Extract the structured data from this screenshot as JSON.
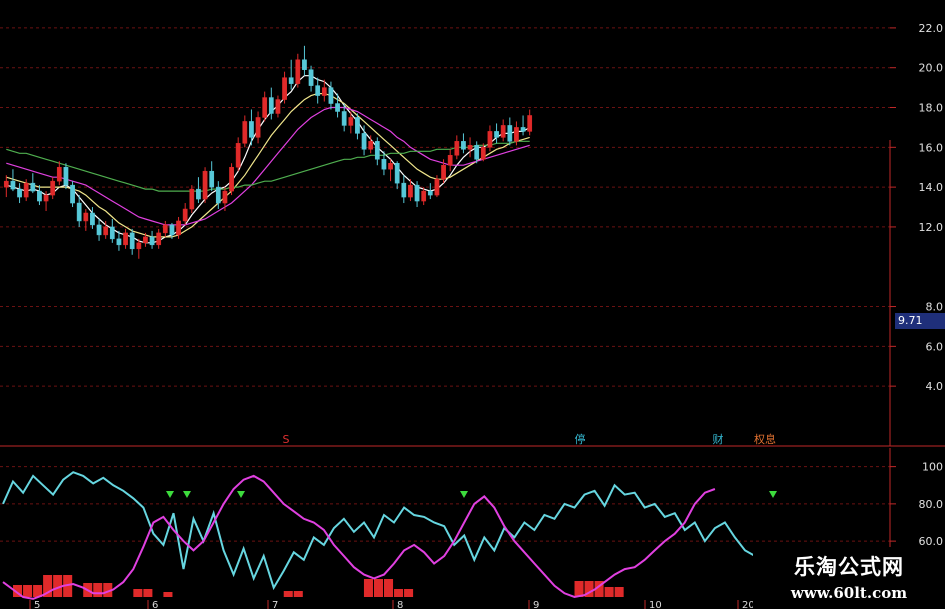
{
  "chart_data": [
    {
      "type": "candlestick",
      "panel": "price",
      "y_ticks": [
        "22.0",
        "20.0",
        "18.0",
        "16.0",
        "14.0",
        "12.0",
        "8.0",
        "6.0",
        "4.0"
      ],
      "current_price": "9.71",
      "ylim": [
        2.5,
        23.0
      ],
      "grid": true,
      "candles": [
        [
          14.0,
          14.6,
          13.5,
          14.3
        ],
        [
          14.3,
          14.9,
          13.8,
          13.9
        ],
        [
          13.9,
          14.2,
          13.2,
          13.5
        ],
        [
          13.5,
          14.4,
          13.3,
          14.2
        ],
        [
          14.2,
          14.7,
          13.7,
          13.8
        ],
        [
          13.8,
          14.1,
          13.1,
          13.3
        ],
        [
          13.3,
          13.8,
          12.8,
          13.6
        ],
        [
          13.6,
          14.5,
          13.4,
          14.3
        ],
        [
          14.3,
          15.3,
          14.1,
          15.0
        ],
        [
          15.0,
          15.2,
          13.9,
          14.1
        ],
        [
          14.1,
          14.3,
          13.0,
          13.2
        ],
        [
          13.2,
          13.6,
          12.0,
          12.3
        ],
        [
          12.3,
          12.9,
          11.8,
          12.7
        ],
        [
          12.7,
          13.0,
          11.9,
          12.1
        ],
        [
          12.1,
          12.4,
          11.3,
          11.6
        ],
        [
          11.6,
          12.3,
          11.4,
          12.0
        ],
        [
          12.0,
          12.4,
          11.2,
          11.4
        ],
        [
          11.4,
          11.8,
          10.8,
          11.1
        ],
        [
          11.1,
          11.9,
          10.9,
          11.7
        ],
        [
          11.7,
          11.9,
          10.6,
          10.9
        ],
        [
          10.9,
          11.4,
          10.4,
          11.2
        ],
        [
          11.2,
          11.7,
          11.0,
          11.5
        ],
        [
          11.5,
          11.8,
          10.9,
          11.1
        ],
        [
          11.1,
          11.9,
          10.9,
          11.7
        ],
        [
          11.7,
          12.3,
          11.5,
          12.1
        ],
        [
          12.1,
          12.2,
          11.4,
          11.6
        ],
        [
          11.6,
          12.5,
          11.4,
          12.3
        ],
        [
          12.3,
          13.2,
          12.1,
          12.9
        ],
        [
          12.9,
          14.1,
          12.7,
          13.9
        ],
        [
          13.9,
          14.5,
          13.2,
          13.4
        ],
        [
          13.4,
          15.0,
          13.2,
          14.8
        ],
        [
          14.8,
          15.3,
          13.8,
          14.0
        ],
        [
          14.0,
          14.3,
          12.9,
          13.2
        ],
        [
          13.2,
          14.0,
          12.8,
          13.8
        ],
        [
          13.8,
          15.2,
          13.6,
          15.0
        ],
        [
          15.0,
          16.5,
          14.8,
          16.2
        ],
        [
          16.2,
          17.6,
          16.0,
          17.3
        ],
        [
          17.3,
          17.9,
          16.1,
          16.5
        ],
        [
          16.5,
          17.8,
          16.2,
          17.5
        ],
        [
          17.5,
          18.8,
          17.3,
          18.5
        ],
        [
          18.5,
          19.0,
          17.4,
          17.7
        ],
        [
          17.7,
          18.6,
          17.5,
          18.4
        ],
        [
          18.4,
          19.8,
          18.2,
          19.5
        ],
        [
          19.5,
          20.4,
          18.9,
          19.2
        ],
        [
          19.2,
          20.7,
          19.0,
          20.4
        ],
        [
          20.4,
          21.1,
          19.6,
          19.9
        ],
        [
          19.9,
          20.1,
          18.8,
          19.1
        ],
        [
          19.1,
          19.5,
          18.2,
          18.6
        ],
        [
          18.6,
          19.4,
          18.3,
          19.0
        ],
        [
          19.0,
          19.3,
          17.9,
          18.2
        ],
        [
          18.2,
          18.7,
          17.5,
          17.8
        ],
        [
          17.8,
          18.2,
          16.8,
          17.1
        ],
        [
          17.1,
          17.8,
          16.7,
          17.5
        ],
        [
          17.5,
          17.7,
          16.4,
          16.7
        ],
        [
          16.7,
          17.1,
          15.6,
          15.9
        ],
        [
          15.9,
          16.6,
          15.7,
          16.3
        ],
        [
          16.3,
          16.5,
          15.1,
          15.4
        ],
        [
          15.4,
          15.8,
          14.6,
          14.9
        ],
        [
          14.9,
          15.4,
          14.3,
          15.2
        ],
        [
          15.2,
          15.3,
          13.9,
          14.2
        ],
        [
          14.2,
          14.6,
          13.2,
          13.5
        ],
        [
          13.5,
          14.4,
          13.3,
          14.1
        ],
        [
          14.1,
          14.3,
          13.0,
          13.3
        ],
        [
          13.3,
          14.0,
          13.1,
          13.8
        ],
        [
          13.8,
          14.2,
          13.4,
          13.6
        ],
        [
          13.6,
          14.6,
          13.5,
          14.4
        ],
        [
          14.4,
          15.4,
          14.2,
          15.1
        ],
        [
          15.1,
          15.9,
          14.8,
          15.6
        ],
        [
          15.6,
          16.6,
          15.4,
          16.3
        ],
        [
          16.3,
          16.7,
          15.7,
          15.9
        ],
        [
          15.9,
          16.5,
          15.5,
          16.1
        ],
        [
          16.1,
          16.3,
          15.2,
          15.4
        ],
        [
          15.4,
          16.2,
          15.3,
          16.0
        ],
        [
          16.0,
          17.1,
          15.8,
          16.8
        ],
        [
          16.8,
          17.2,
          16.2,
          16.5
        ],
        [
          16.5,
          17.4,
          16.3,
          17.1
        ],
        [
          17.1,
          17.5,
          16.1,
          16.3
        ],
        [
          16.3,
          17.3,
          16.1,
          17.0
        ],
        [
          17.0,
          17.6,
          16.6,
          16.8
        ],
        [
          16.8,
          17.9,
          16.6,
          17.6
        ]
      ],
      "moving_averages": [
        {
          "color": "#ffffff",
          "values": [
            14.1,
            14.0,
            13.9,
            13.8,
            13.9,
            13.8,
            13.6,
            13.7,
            14.0,
            14.1,
            13.9,
            13.5,
            13.1,
            12.7,
            12.4,
            12.1,
            11.9,
            11.7,
            11.6,
            11.5,
            11.3,
            11.2,
            11.2,
            11.3,
            11.5,
            11.6,
            11.8,
            12.1,
            12.6,
            13.0,
            13.4,
            13.7,
            13.9,
            14.0,
            14.3,
            14.8,
            15.5,
            16.3,
            16.9,
            17.4,
            17.8,
            18.1,
            18.5,
            18.8,
            19.3,
            19.6,
            19.6,
            19.4,
            19.3,
            19.0,
            18.6,
            18.1,
            17.7,
            17.3,
            16.8,
            16.4,
            16.0,
            15.7,
            15.4,
            15.0,
            14.6,
            14.3,
            14.0,
            13.9,
            13.8,
            13.9,
            14.2,
            14.6,
            15.1,
            15.5,
            15.8,
            16.0,
            16.0,
            16.2,
            16.5,
            16.7,
            16.7,
            16.8,
            16.8,
            17.0
          ]
        },
        {
          "color": "#f0e68c",
          "values": [
            14.5,
            14.4,
            14.3,
            14.2,
            14.1,
            14.0,
            14.0,
            14.0,
            14.0,
            14.0,
            13.9,
            13.8,
            13.6,
            13.3,
            13.0,
            12.8,
            12.5,
            12.2,
            12.0,
            11.8,
            11.7,
            11.6,
            11.5,
            11.5,
            11.5,
            11.5,
            11.6,
            11.8,
            12.0,
            12.3,
            12.6,
            12.9,
            13.2,
            13.5,
            13.8,
            14.2,
            14.6,
            15.1,
            15.6,
            16.1,
            16.6,
            17.0,
            17.4,
            17.8,
            18.1,
            18.4,
            18.6,
            18.7,
            18.7,
            18.6,
            18.4,
            18.2,
            17.9,
            17.6,
            17.3,
            17.0,
            16.7,
            16.4,
            16.1,
            15.8,
            15.5,
            15.2,
            14.9,
            14.7,
            14.5,
            14.4,
            14.4,
            14.5,
            14.7,
            14.9,
            15.1,
            15.3,
            15.5,
            15.7,
            15.9,
            16.0,
            16.2,
            16.3,
            16.4,
            16.5
          ]
        },
        {
          "color": "#e040e0",
          "values": [
            15.2,
            15.1,
            15.0,
            14.9,
            14.8,
            14.7,
            14.6,
            14.5,
            14.5,
            14.4,
            14.3,
            14.2,
            14.1,
            13.9,
            13.7,
            13.5,
            13.3,
            13.1,
            12.9,
            12.7,
            12.5,
            12.4,
            12.3,
            12.2,
            12.1,
            12.1,
            12.1,
            12.1,
            12.2,
            12.3,
            12.4,
            12.6,
            12.8,
            13.0,
            13.2,
            13.5,
            13.8,
            14.1,
            14.5,
            14.9,
            15.3,
            15.7,
            16.1,
            16.5,
            16.9,
            17.2,
            17.5,
            17.7,
            17.9,
            18.0,
            18.0,
            18.0,
            17.9,
            17.8,
            17.6,
            17.4,
            17.2,
            17.0,
            16.8,
            16.5,
            16.3,
            16.0,
            15.8,
            15.6,
            15.4,
            15.3,
            15.2,
            15.1,
            15.1,
            15.1,
            15.2,
            15.3,
            15.4,
            15.5,
            15.6,
            15.7,
            15.8,
            15.9,
            16.0,
            16.1
          ]
        },
        {
          "color": "#4fae4f",
          "values": [
            15.9,
            15.8,
            15.7,
            15.7,
            15.6,
            15.5,
            15.4,
            15.3,
            15.2,
            15.1,
            15.0,
            14.9,
            14.8,
            14.7,
            14.6,
            14.5,
            14.4,
            14.3,
            14.2,
            14.1,
            14.0,
            13.9,
            13.9,
            13.8,
            13.8,
            13.8,
            13.8,
            13.8,
            13.8,
            13.8,
            13.8,
            13.9,
            13.9,
            13.9,
            14.0,
            14.0,
            14.1,
            14.1,
            14.2,
            14.3,
            14.3,
            14.4,
            14.5,
            14.6,
            14.7,
            14.8,
            14.9,
            15.0,
            15.1,
            15.2,
            15.3,
            15.4,
            15.4,
            15.5,
            15.5,
            15.6,
            15.6,
            15.6,
            15.7,
            15.7,
            15.7,
            15.8,
            15.8,
            15.8,
            15.8,
            15.9,
            15.9,
            15.9,
            16.0,
            16.0,
            16.0,
            16.1,
            16.1,
            16.1,
            16.2,
            16.2,
            16.2,
            16.3,
            16.3,
            16.3
          ]
        }
      ]
    },
    {
      "type": "line",
      "panel": "oscillator",
      "y_ticks": [
        "100",
        "80.0",
        "60.0"
      ],
      "ylim": [
        30,
        110
      ],
      "series": [
        {
          "color": "#66d6e0",
          "values": [
            80,
            92,
            86,
            95,
            90,
            85,
            93,
            97,
            95,
            91,
            94,
            90,
            87,
            83,
            78,
            64,
            58,
            75,
            45,
            72,
            60,
            75,
            55,
            42,
            56,
            40,
            52,
            35,
            44,
            54,
            50,
            62,
            58,
            67,
            72,
            65,
            70,
            62,
            74,
            70,
            78,
            74,
            73,
            70,
            68,
            58,
            63,
            50,
            62,
            55,
            67,
            62,
            70,
            66,
            74,
            72,
            80,
            78,
            85,
            87,
            79,
            90,
            85,
            86,
            78,
            80,
            73,
            75,
            66,
            70,
            60,
            67,
            70,
            62,
            55,
            52
          ]
        },
        {
          "color": "#e040e0",
          "values": [
            38,
            34,
            30,
            29,
            31,
            34,
            36,
            37,
            35,
            32,
            32,
            34,
            38,
            45,
            57,
            70,
            73,
            66,
            60,
            55,
            60,
            70,
            80,
            88,
            93,
            95,
            92,
            86,
            80,
            76,
            72,
            70,
            66,
            58,
            52,
            46,
            42,
            40,
            42,
            48,
            55,
            58,
            54,
            48,
            52,
            60,
            70,
            80,
            84,
            78,
            68,
            60,
            54,
            48,
            42,
            36,
            32,
            30,
            31,
            34,
            38,
            42,
            45,
            46,
            50,
            55,
            60,
            64,
            70,
            80,
            86,
            88
          ]
        }
      ]
    }
  ],
  "panel_markers": [
    {
      "text": "S",
      "color": "#e03030"
    },
    {
      "text": "停",
      "color": "#35b7d0"
    },
    {
      "text": "财",
      "color": "#35b7d0"
    },
    {
      "text": "权息",
      "color": "#e07030"
    }
  ],
  "date_labels": [
    "5",
    "6",
    "7",
    "8",
    "9",
    "10",
    "20"
  ],
  "watermark": {
    "title": "乐淘公式网",
    "url": "www.60lt.com"
  },
  "colors": {
    "up": "#e02a2a",
    "down": "#57c8d8",
    "grid": "#6b1212",
    "axis": "#c02828"
  }
}
